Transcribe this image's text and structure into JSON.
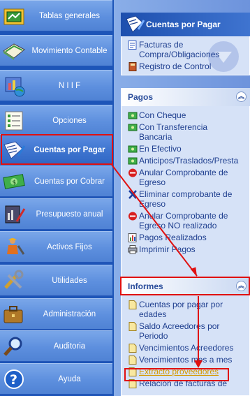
{
  "nav": {
    "items": [
      {
        "label": "Tablas generales",
        "icon": "folder-table-icon"
      },
      {
        "label": "Movimiento Contable",
        "icon": "ledger-book-icon"
      },
      {
        "label": "N I I F",
        "icon": "globe-chart-icon"
      },
      {
        "label": "Opciones",
        "icon": "checklist-icon"
      },
      {
        "label": "Cuentas por Pagar",
        "icon": "document-pen-icon"
      },
      {
        "label": "Cuentas por Cobrar",
        "icon": "money-bill-icon"
      },
      {
        "label": "Presupuesto anual",
        "icon": "chart-pen-icon"
      },
      {
        "label": "Activos Fijos",
        "icon": "worker-icon"
      },
      {
        "label": "Utilidades",
        "icon": "tools-icon"
      },
      {
        "label": "Administración",
        "icon": "briefcase-icon"
      },
      {
        "label": "Auditoria",
        "icon": "magnifier-icon"
      },
      {
        "label": "Ayuda",
        "icon": "help-icon"
      }
    ],
    "active_index": 4
  },
  "cuentas_panel": {
    "title": "Cuentas por Pagar",
    "tasks": [
      {
        "label": "Facturas de Compra/Obligaciones",
        "icon": "document-list-icon"
      },
      {
        "label": "Registro de Control",
        "icon": "book-icon"
      }
    ]
  },
  "pagos_panel": {
    "title": "Pagos",
    "tasks": [
      {
        "label": "Con Cheque",
        "icon": "money-icon"
      },
      {
        "label": "Con Transferencia Bancaria",
        "icon": "money-icon"
      },
      {
        "label": "En Efectivo",
        "icon": "money-icon"
      },
      {
        "label": "Anticipos/Traslados/Presta",
        "icon": "money-icon"
      },
      {
        "label": "Anular Comprobante de Egreso",
        "icon": "no-entry-icon"
      },
      {
        "label": "Eliminar comprobante de Egreso",
        "icon": "delete-x-icon"
      },
      {
        "label": "Anular Comprobante de Egreso NO realizado",
        "icon": "no-entry-icon"
      },
      {
        "label": "Pagos Realizados",
        "icon": "report-icon"
      },
      {
        "label": "Imprimir Pagos",
        "icon": "printer-icon"
      }
    ]
  },
  "informes_panel": {
    "title": "Informes",
    "tasks": [
      {
        "label": "Cuentas por pagar por edades",
        "icon": "page-icon"
      },
      {
        "label": "Saldo Acreedores por Periodo",
        "icon": "page-icon"
      },
      {
        "label": "Vencimientos Acreedores",
        "icon": "page-icon"
      },
      {
        "label": "Vencimientos mes a mes",
        "icon": "page-icon"
      },
      {
        "label": "Extracto proveedores",
        "icon": "page-icon"
      },
      {
        "label": "Relación de facturas de",
        "icon": "page-icon"
      }
    ],
    "selected_index": 4
  },
  "colors": {
    "highlight": "#e01010",
    "link": "#1f3f8f",
    "selected_link": "#d49a00"
  }
}
